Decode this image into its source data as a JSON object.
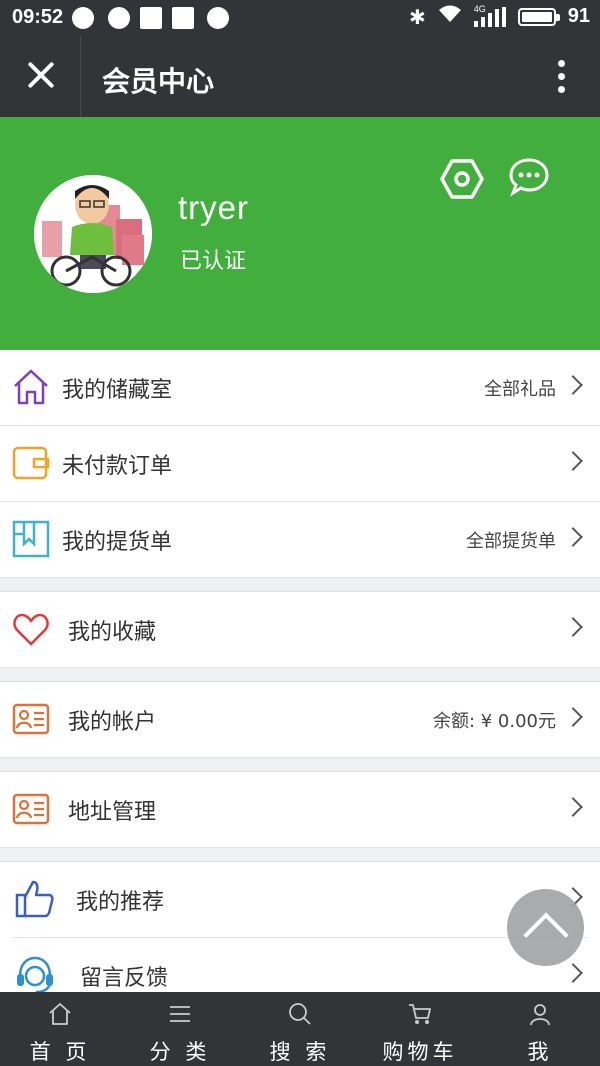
{
  "status_bar": {
    "time": "09:52",
    "battery": "91",
    "network": "4G"
  },
  "title_bar": {
    "title": "会员中心"
  },
  "profile": {
    "username": "tryer",
    "status": "已认证"
  },
  "menu": {
    "storage": {
      "label": "我的储藏室",
      "extra": "全部礼品"
    },
    "unpaid": {
      "label": "未付款订单"
    },
    "pickup": {
      "label": "我的提货单",
      "extra": "全部提货单"
    },
    "favorites": {
      "label": "我的收藏"
    },
    "account": {
      "label": "我的帐户",
      "extra": "余额: ¥  0.00元"
    },
    "address": {
      "label": "地址管理"
    },
    "recommend": {
      "label": "我的推荐"
    },
    "feedback": {
      "label": "留言反馈"
    }
  },
  "bottom_nav": {
    "home": "首 页",
    "category": "分 类",
    "search": "搜 索",
    "cart": "购物车",
    "me": "我"
  },
  "colors": {
    "header_green": "#42ae3d",
    "bar_dark": "#333437",
    "storage_icon": "#7b3fc0",
    "unpaid_icon": "#f0a526",
    "pickup_icon": "#3fb2c8",
    "favorites_icon": "#e03a3a",
    "account_icon": "#d9733a",
    "recommend_icon": "#3a5fc0",
    "feedback_icon": "#2f8fd0"
  }
}
